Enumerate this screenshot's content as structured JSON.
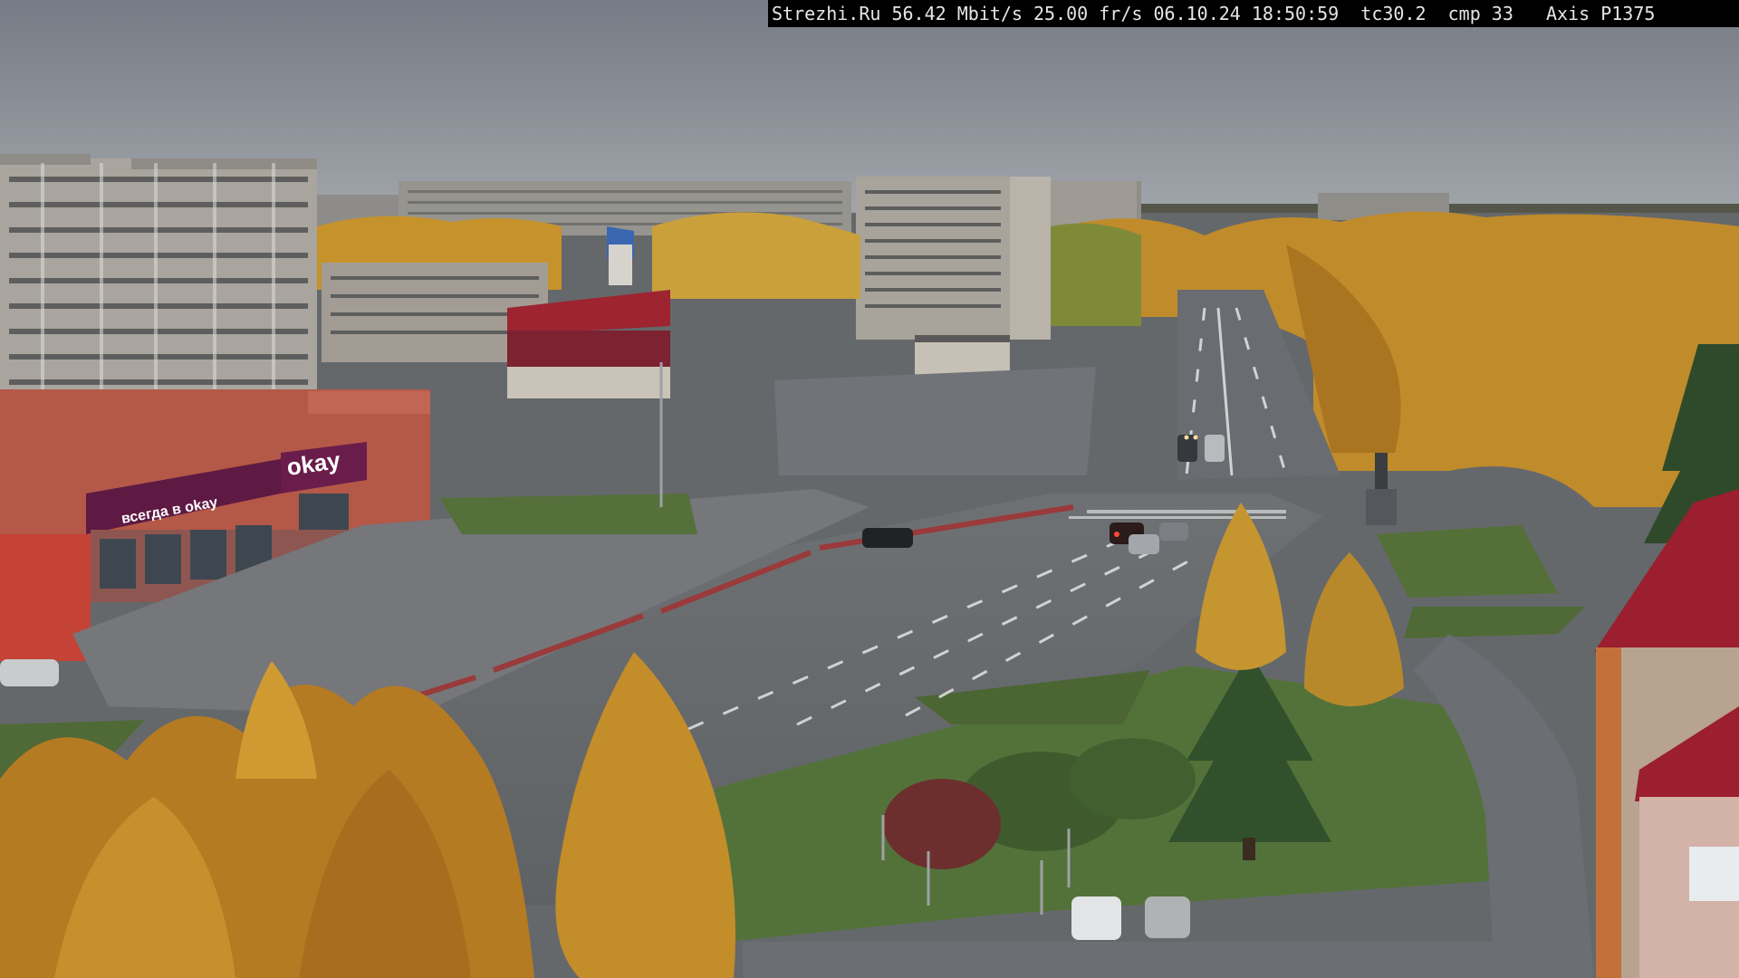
{
  "overlay": {
    "site": "Strezhi.Ru",
    "bitrate": "56.42 Mbit/s",
    "framerate": "25.00 fr/s",
    "date": "06.10.24",
    "time": "18:50:59",
    "tc": "tc30.2",
    "cmp": "cmp 33",
    "camera": "Axis P1375"
  },
  "signs": {
    "store_main": "okay",
    "store_secondary": "всегда в okay"
  },
  "colors": {
    "sky_top": "#7d828b",
    "sky_horizon": "#9aa0a6",
    "foliage": "#c9962e",
    "asphalt": "#6c6f72",
    "grass": "#4f6a36",
    "store_facade": "#b5574a",
    "store_banner": "#6a1d4a",
    "roof_red": "#a3202d"
  }
}
